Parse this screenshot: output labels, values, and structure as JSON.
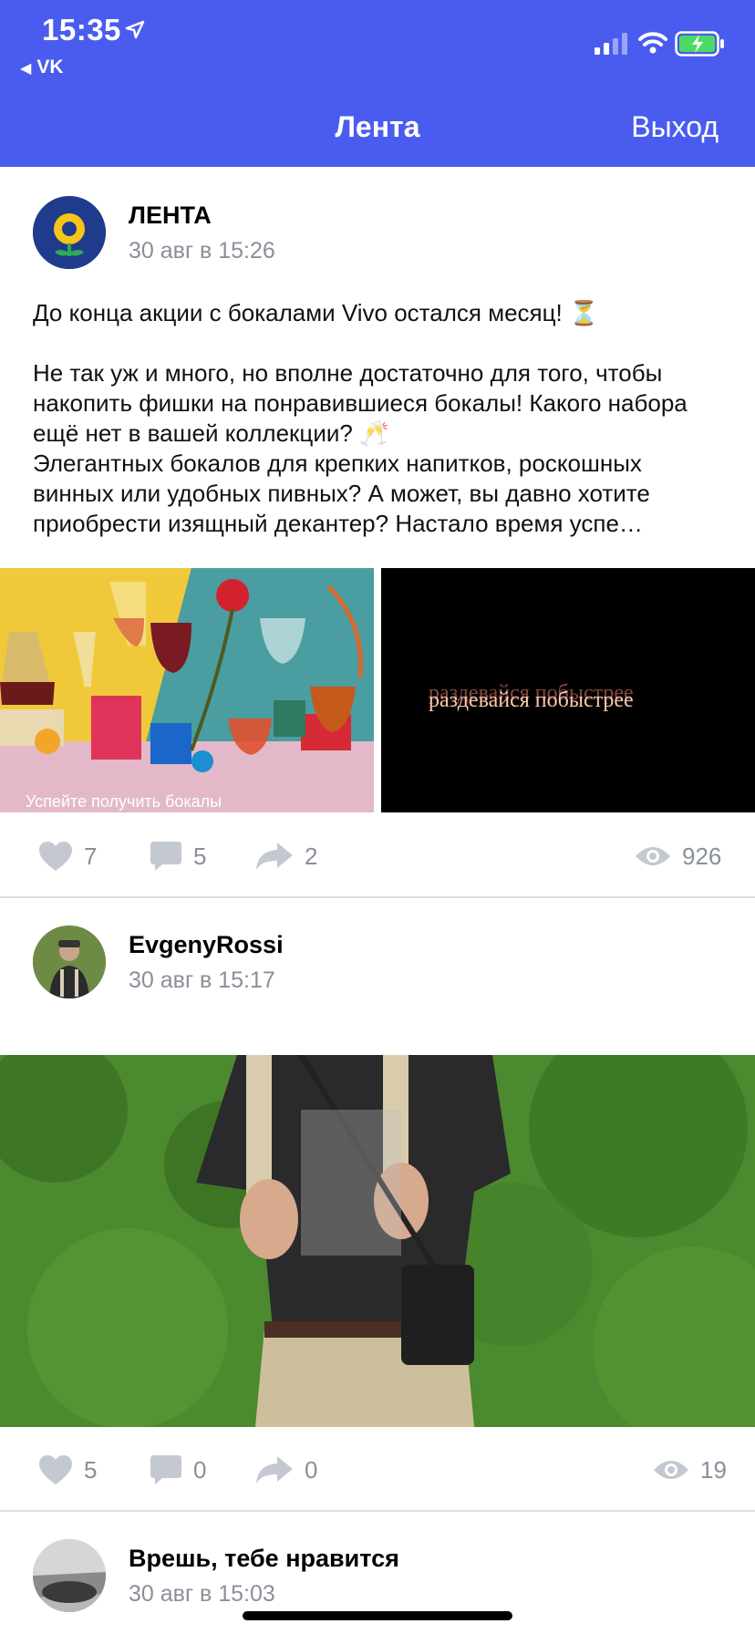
{
  "status": {
    "time": "15:35",
    "back_app": "VK"
  },
  "nav": {
    "title": "Лента",
    "logout": "Выход"
  },
  "posts": [
    {
      "author": "ЛЕНТА",
      "date": "30 авг в 15:26",
      "text": "До конца акции с бокалами Vivo остался месяц! ⏳\n\nНе так уж и много, но вполне достаточно для того, чтобы накопить фишки на понравившиеся бокалы! Какого набора ещё нет в вашей коллекции? 🥂\nЭлегантных бокалов для крепких напитков, роскошных винных или удобных пивных? А может, вы давно хотите приобрести изящный декантер? Настало время успе…",
      "image_caption": "Успейте получить бокалы",
      "video_caption": "раздевайся побыстрее",
      "likes": "7",
      "comments": "5",
      "reposts": "2",
      "views": "926"
    },
    {
      "author": "EvgenyRossi",
      "date": "30 авг в 15:17",
      "likes": "5",
      "comments": "0",
      "reposts": "0",
      "views": "19"
    },
    {
      "author": "Врешь, тебе нравится",
      "date": "30 авг в 15:03"
    }
  ],
  "colors": {
    "accent": "#4a5cf0",
    "muted": "#8a8f99",
    "icon": "#c4c8d0"
  }
}
